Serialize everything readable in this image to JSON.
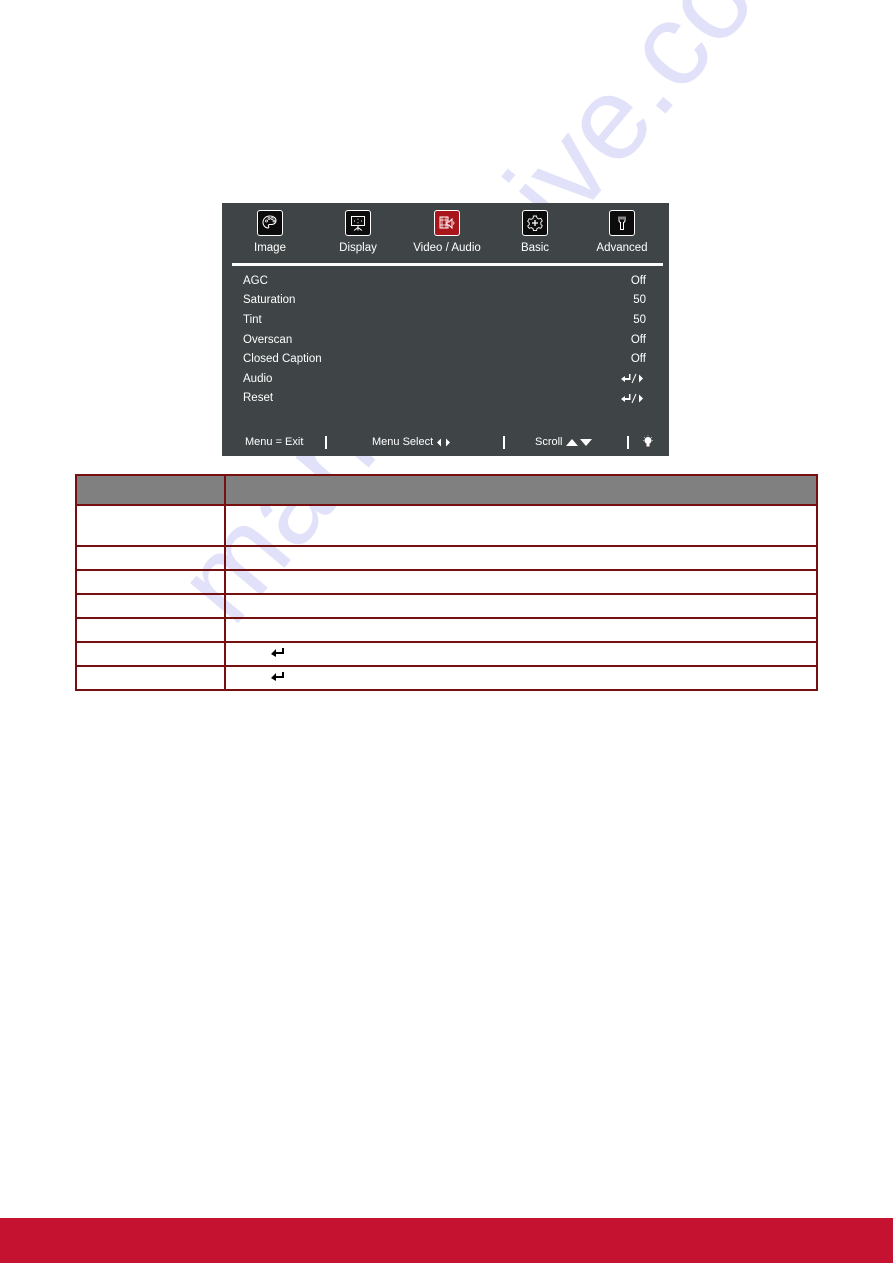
{
  "osd": {
    "tabs": [
      {
        "label": "Image",
        "icon": "palette-icon",
        "active": false
      },
      {
        "label": "Display",
        "icon": "projection-screen-icon",
        "active": false
      },
      {
        "label": "Video / Audio",
        "icon": "film-speaker-icon",
        "active": true
      },
      {
        "label": "Basic",
        "icon": "gear-plus-icon",
        "active": false
      },
      {
        "label": "Advanced",
        "icon": "wrench-icon",
        "active": false
      }
    ],
    "rows": [
      {
        "label": "AGC",
        "value": "Off"
      },
      {
        "label": "Saturation",
        "value": "50"
      },
      {
        "label": "Tint",
        "value": "50"
      },
      {
        "label": "Overscan",
        "value": "Off"
      },
      {
        "label": "Closed Caption",
        "value": "Off"
      },
      {
        "label": "Audio",
        "value": "enter-or-right-icon"
      },
      {
        "label": "Reset",
        "value": "enter-or-right-icon"
      }
    ],
    "footer": {
      "exit": "Menu = Exit",
      "select": "Menu Select",
      "scroll": "Scroll"
    },
    "colors": {
      "background": "#3f4546",
      "active_tab": "#a8161c"
    }
  },
  "table": {
    "headers": [
      "",
      ""
    ],
    "rows": [
      {
        "item": "",
        "description": ""
      },
      {
        "item": "",
        "description": ""
      },
      {
        "item": "",
        "description": ""
      },
      {
        "item": "",
        "description": ""
      },
      {
        "item": "",
        "description": ""
      },
      {
        "item": "",
        "description": "",
        "icon": "enter-icon"
      },
      {
        "item": "",
        "description": "",
        "icon": "enter-icon"
      }
    ],
    "colors": {
      "border": "#760f0f",
      "header_bg": "#808080"
    }
  },
  "watermark": "manualshive.com",
  "page": {
    "footer_color": "#c41230"
  }
}
